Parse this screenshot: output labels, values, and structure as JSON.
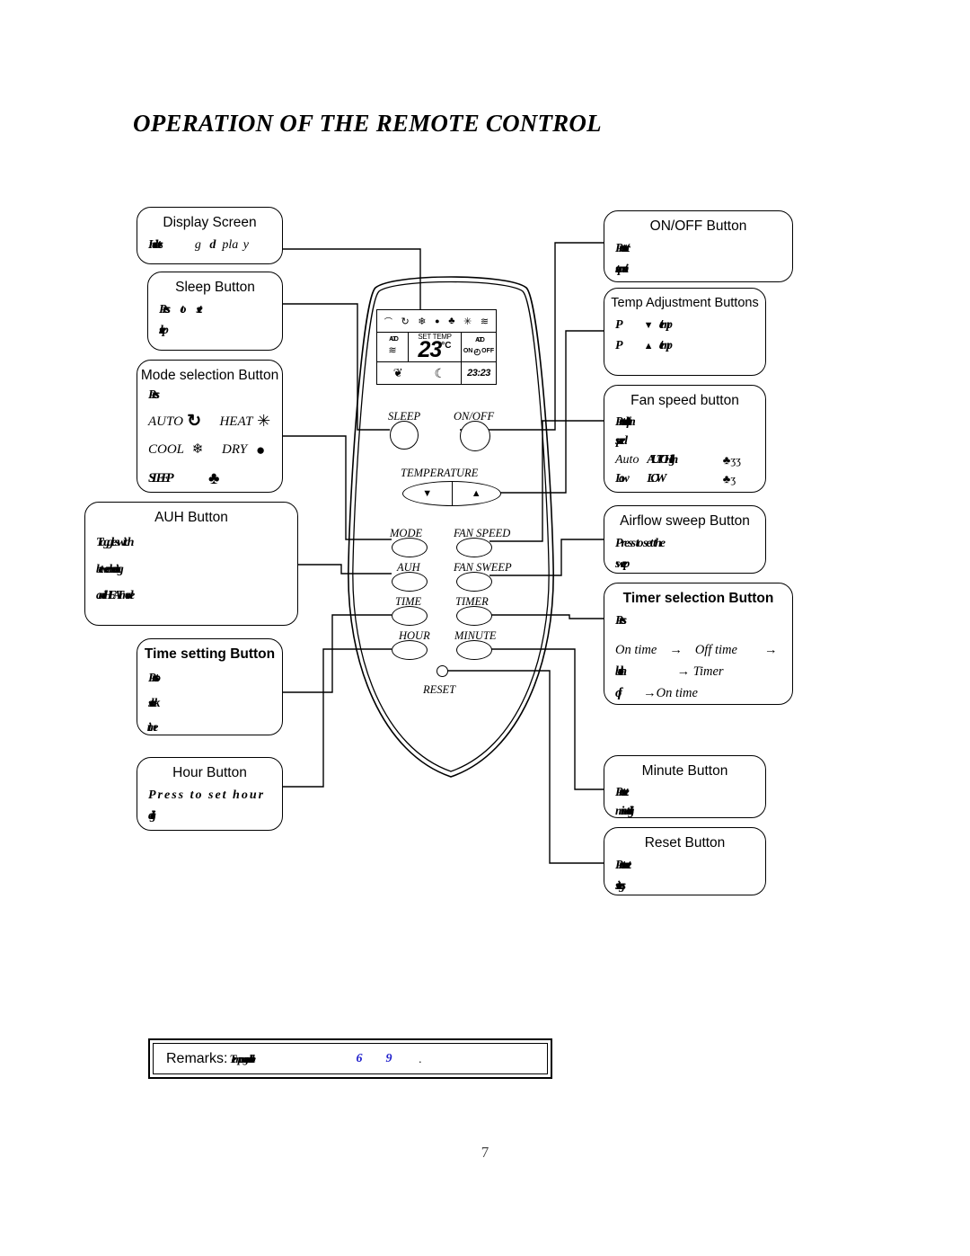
{
  "title": "OPERATION OF THE REMOTE CONTROL",
  "page_number": "7",
  "callouts": {
    "display_screen": {
      "header": "Display Screen",
      "line1": "Indicates",
      "line2": "g",
      "line3": "d",
      "line4": "pla",
      "line5": "y"
    },
    "sleep_button": {
      "header": "Sleep Button",
      "line1": "Press",
      "line2": "to",
      "line3": "set",
      "line4": "sleep"
    },
    "mode_selection": {
      "header": "Mode selection Button",
      "line1": "Press",
      "modes": [
        {
          "label": "AUTO",
          "icon": "auto-circulate-icon",
          "glyph": "↻"
        },
        {
          "label": "HEAT",
          "icon": "sun-icon",
          "glyph": "✳"
        },
        {
          "label": "COOL",
          "icon": "snowflake-icon",
          "glyph": "❄"
        },
        {
          "label": "DRY",
          "icon": "water-drop-icon",
          "glyph": "●"
        },
        {
          "label": "SLEEP",
          "icon": "fan-icon",
          "glyph": "♣"
        }
      ]
    },
    "auh_button": {
      "header": "AUH Button",
      "line1": "Toggle switch",
      "line2": "between heating",
      "line3": "and HEAT mode"
    },
    "time_setting": {
      "header": "Time setting Button",
      "line1": "Press to",
      "line2": "set clock",
      "line3": "time",
      "bold": true
    },
    "hour_button": {
      "header": "Hour Button",
      "line1": "Press to set hour",
      "line2": "digits"
    },
    "on_off_button": {
      "header": "ON/OFF Button",
      "line1": "Press to start/",
      "line2": "stop unit"
    },
    "temp_adjustment": {
      "header": "Temp Adjustment Buttons",
      "row1": "Press ▼ to lower temp",
      "row2": "Press ▲ to raise temp",
      "down_arrow": "▼",
      "up_arrow": "▲"
    },
    "fan_speed": {
      "header": "Fan speed button",
      "line1": "Press to select fan",
      "line2": "speed",
      "rows": [
        {
          "c1": "Auto",
          "c2": "AUTO High",
          "c3": "♣ʒʒ"
        },
        {
          "c1": "Low",
          "c2": "LOW",
          "c3": "♣ʒ"
        }
      ]
    },
    "airflow_sweep": {
      "header": "Airflow sweep Button",
      "line1": "Press to set the",
      "line2": "sweep"
    },
    "timer_selection": {
      "header": "Timer selection Button",
      "bold": true,
      "line1": "Press",
      "cycle": [
        {
          "a": "On time",
          "arrow1": "→",
          "b": "Off time",
          "arrow2": "→"
        },
        {
          "a": "both",
          "arrow1": "",
          "b": "→ Timer",
          "arrow2": ""
        },
        {
          "a": "off",
          "arrow1": "→",
          "b": "On time",
          "arrow2": ""
        }
      ]
    },
    "minute_button": {
      "header": "Minute Button",
      "line1": "Press to set",
      "line2": "minute digits"
    },
    "reset_button": {
      "header": "Reset Button",
      "line1": "Press to reset",
      "line2": "settings"
    }
  },
  "remote": {
    "lcd": {
      "signal_icon": "⌒",
      "top_icons": [
        "↻",
        "❄",
        "●",
        "♣",
        "✳",
        "≋"
      ],
      "set_temp_label": "SET TEMP",
      "temperature": "23",
      "degree": "°C",
      "fan_indicator": "AUTO",
      "timer_on": "ON",
      "timer_off": "OFF",
      "clock_icon": "◴",
      "clock_time": "23:23",
      "leaf_icon": "❦",
      "moon_icon": "☾",
      "sweep_icon": "≋"
    },
    "buttons": [
      {
        "name": "sleep",
        "label": "SLEEP"
      },
      {
        "name": "on-off",
        "label": "ON/OFF"
      },
      {
        "name": "temperature",
        "label": "TEMPERATURE",
        "down": "▼",
        "up": "▲"
      },
      {
        "name": "mode",
        "label": "MODE"
      },
      {
        "name": "fan-speed",
        "label": "FAN SPEED"
      },
      {
        "name": "auh",
        "label": "AUH"
      },
      {
        "name": "fan-sweep",
        "label": "FAN SWEEP"
      },
      {
        "name": "time",
        "label": "TIME"
      },
      {
        "name": "timer",
        "label": "TIMER"
      },
      {
        "name": "hour",
        "label": "HOUR"
      },
      {
        "name": "minute",
        "label": "MINUTE"
      },
      {
        "name": "reset",
        "label": "RESET"
      }
    ]
  },
  "remarks": {
    "label": "Remarks:",
    "text": "Temp range available",
    "num1": "6",
    "num2": "9",
    "period": "."
  }
}
